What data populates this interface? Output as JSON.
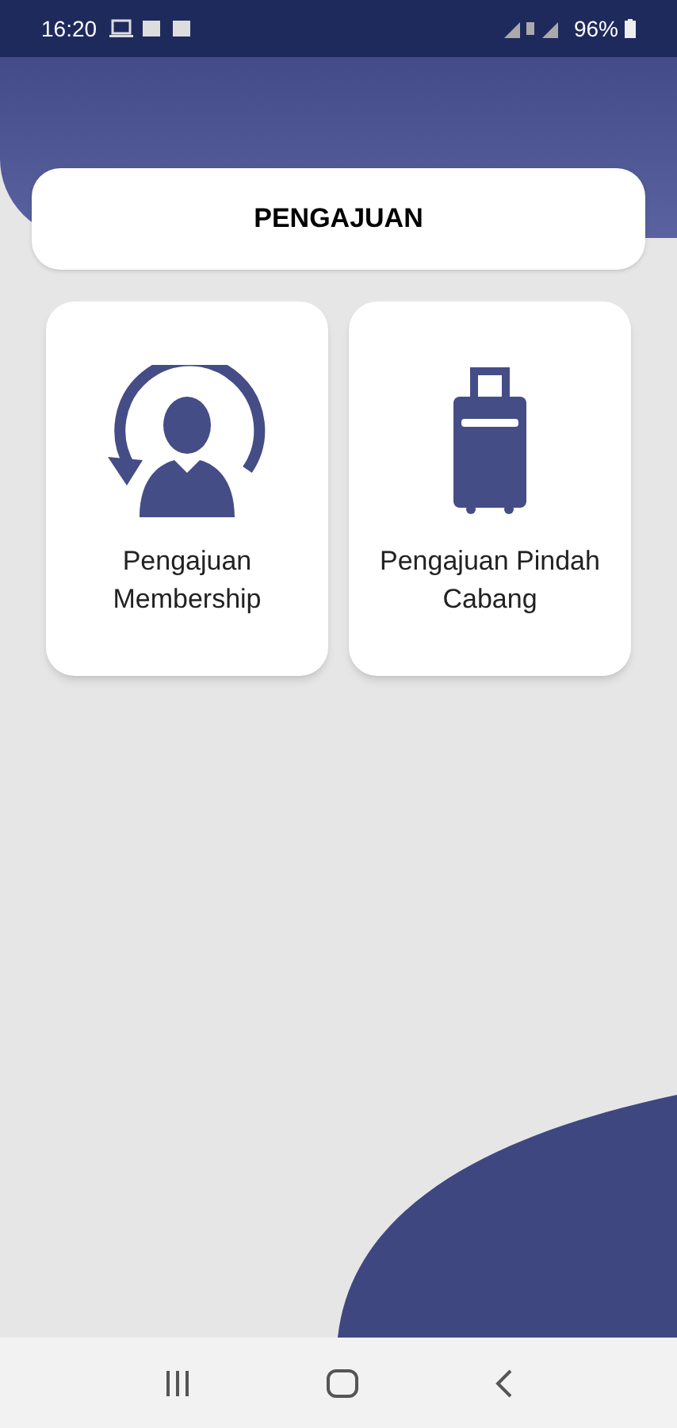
{
  "status_bar": {
    "time": "16:20",
    "battery": "96%"
  },
  "header": {
    "title": "PENGAJUAN"
  },
  "menu": [
    {
      "kind": "membership",
      "label": "Pengajuan Membership"
    },
    {
      "kind": "luggage",
      "label": "Pengajuan Pindah Cabang"
    }
  ]
}
